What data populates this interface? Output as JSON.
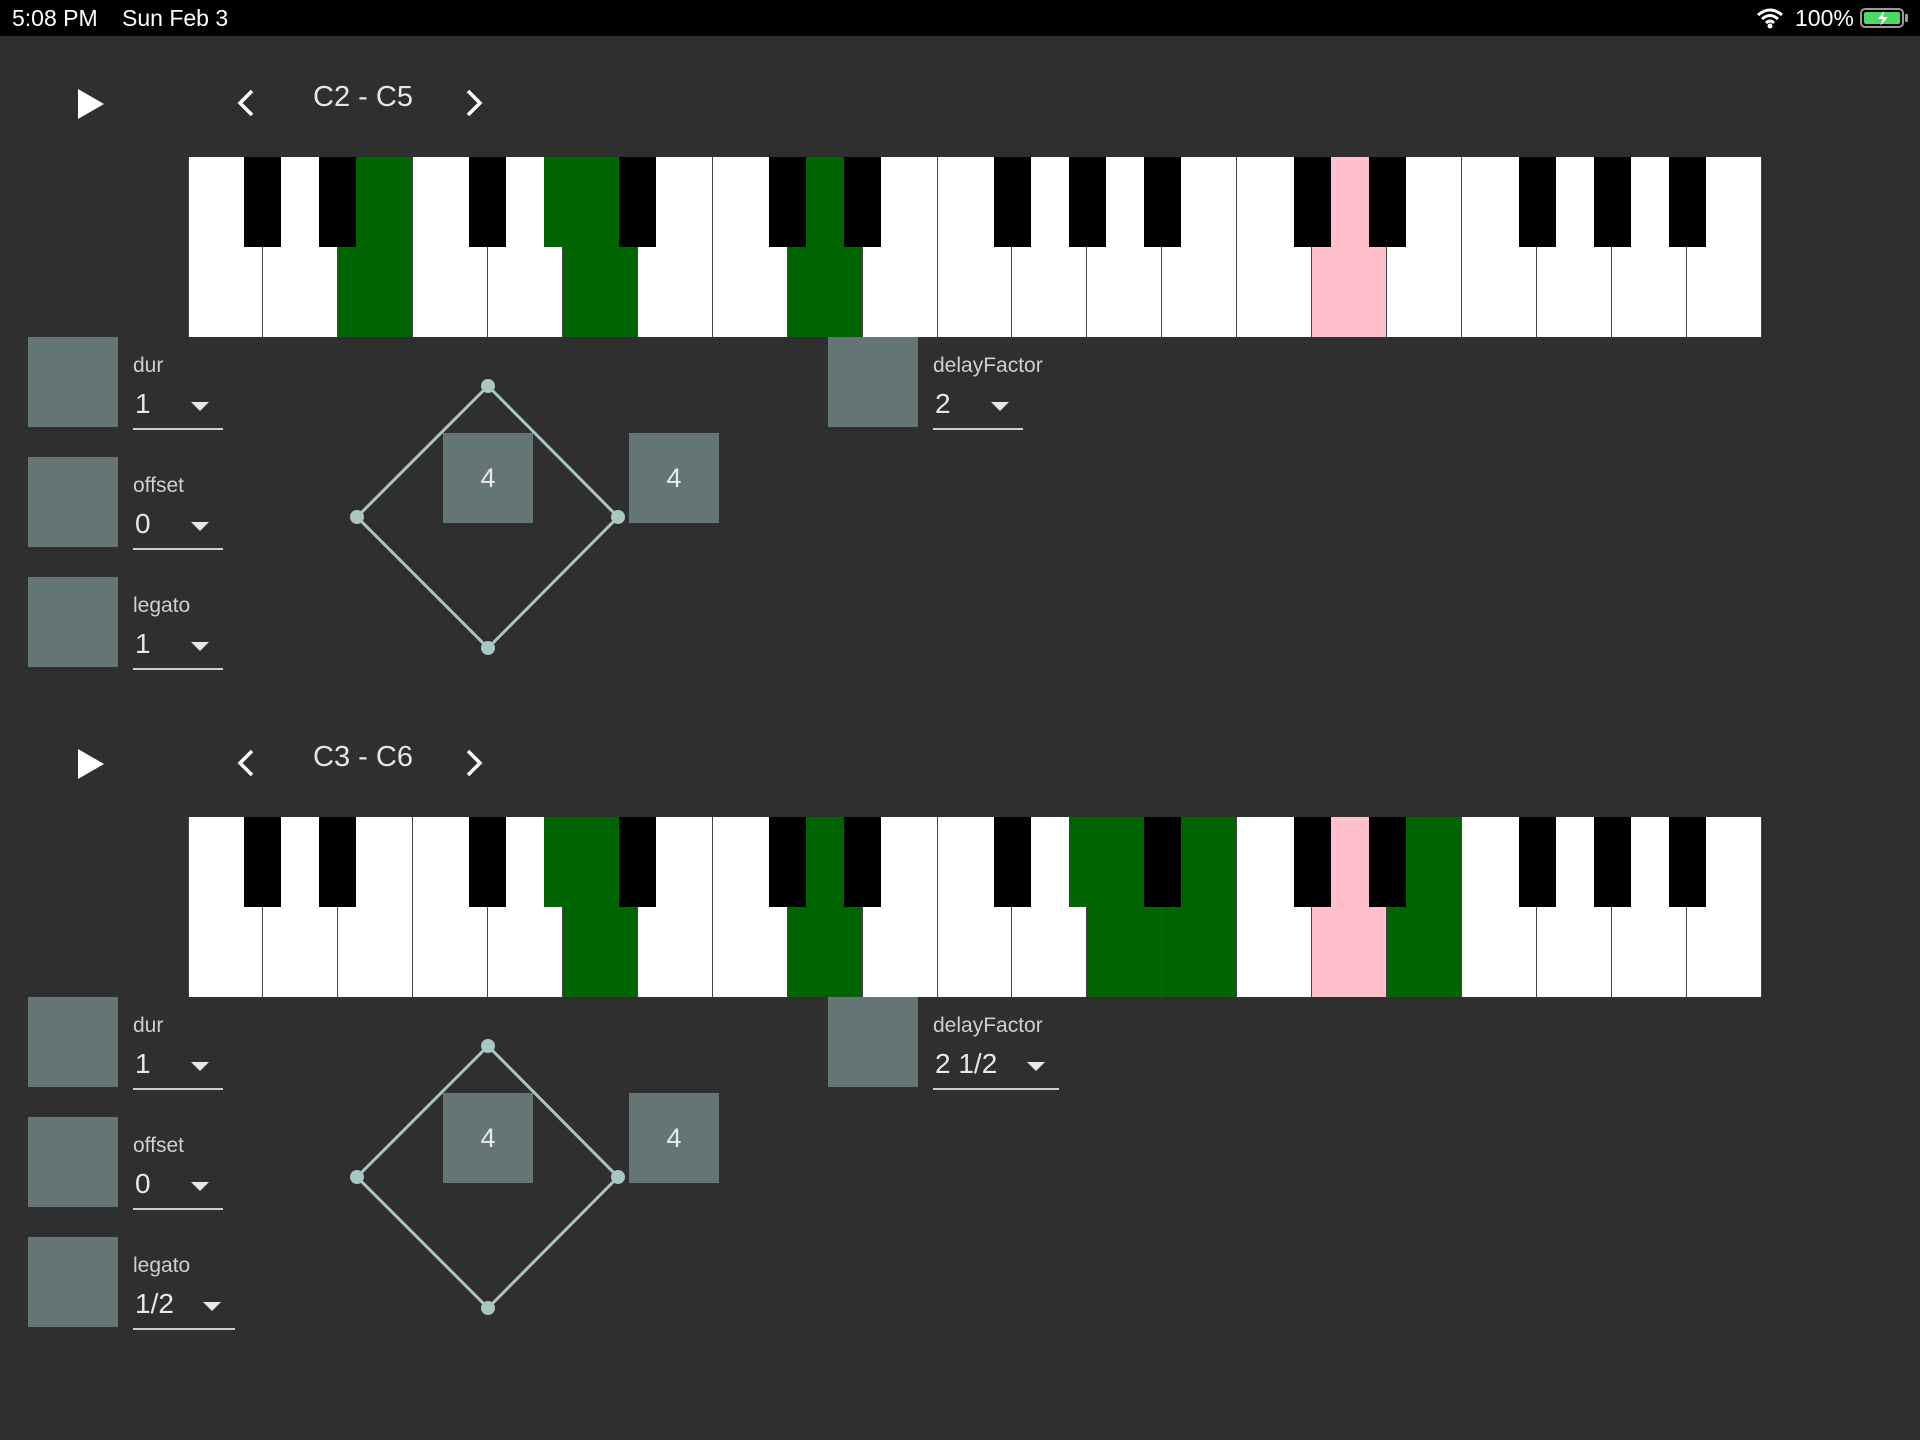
{
  "status_bar": {
    "time": "5:08 PM",
    "date": "Sun Feb 3",
    "battery": "100%"
  },
  "colors": {
    "active_key": "#006400",
    "marker_key": "#ffc0cb",
    "param_box": "#657474",
    "background": "#2f2f2f"
  },
  "sections": [
    {
      "range": "C2 - C5",
      "active_white_keys": [
        2,
        5,
        8
      ],
      "active_black_keys": [
        3
      ],
      "marker_white_keys": [
        15
      ],
      "params": [
        {
          "label": "dur",
          "value": "1"
        },
        {
          "label": "offset",
          "value": "0"
        },
        {
          "label": "legato",
          "value": "1"
        }
      ],
      "delay": {
        "label": "delayFactor",
        "value": "2"
      },
      "center_value": "4",
      "side_value": "4"
    },
    {
      "range": "C3 - C6",
      "active_white_keys": [
        5,
        8,
        12,
        13,
        16
      ],
      "active_black_keys": [
        3,
        8
      ],
      "marker_white_keys": [
        15
      ],
      "params": [
        {
          "label": "dur",
          "value": "1"
        },
        {
          "label": "offset",
          "value": "0"
        },
        {
          "label": "legato",
          "value": "1/2"
        }
      ],
      "delay": {
        "label": "delayFactor",
        "value": "2 1/2"
      },
      "center_value": "4",
      "side_value": "4"
    }
  ]
}
